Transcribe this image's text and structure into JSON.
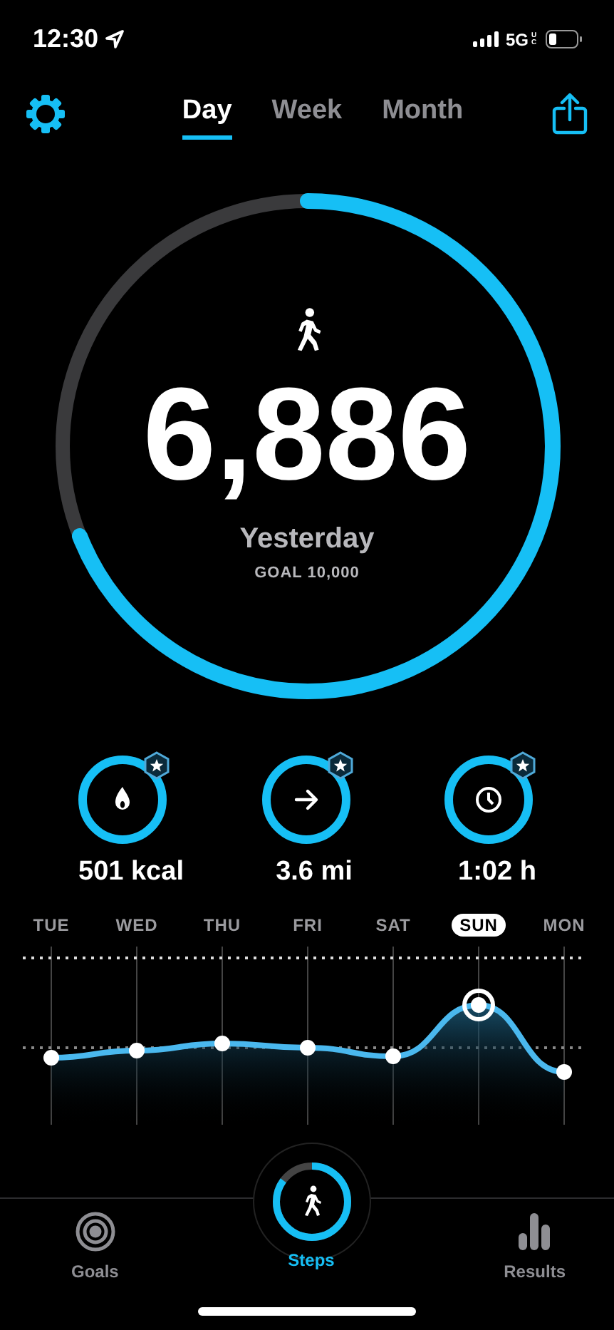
{
  "status_bar": {
    "time": "12:30",
    "network": "5G",
    "network_badge": "UC"
  },
  "header": {
    "tabs": [
      {
        "label": "Day",
        "selected": true
      },
      {
        "label": "Week",
        "selected": false
      },
      {
        "label": "Month",
        "selected": false
      }
    ]
  },
  "steps_ring": {
    "level": 0.69,
    "count": "6,886",
    "day": "Yesterday",
    "goal": "GOAL 10,000"
  },
  "stats": [
    {
      "kind": "calories",
      "value": "501 kcal"
    },
    {
      "kind": "distance",
      "value": "3.6 mi"
    },
    {
      "kind": "duration",
      "value": "1:02 h"
    }
  ],
  "week_chart": {
    "days": [
      {
        "label": "TUE",
        "selected": false
      },
      {
        "label": "WED",
        "selected": false
      },
      {
        "label": "THU",
        "selected": false
      },
      {
        "label": "FRI",
        "selected": false
      },
      {
        "label": "SAT",
        "selected": false
      },
      {
        "label": "SUN",
        "selected": true
      },
      {
        "label": "MON",
        "selected": false
      }
    ]
  },
  "tab_bar": {
    "items": [
      {
        "kind": "goals",
        "label": "Goals",
        "selected": false
      },
      {
        "kind": "steps",
        "label": "Steps",
        "selected": true,
        "level": 0.85
      },
      {
        "kind": "results",
        "label": "Results",
        "selected": false
      }
    ]
  }
}
